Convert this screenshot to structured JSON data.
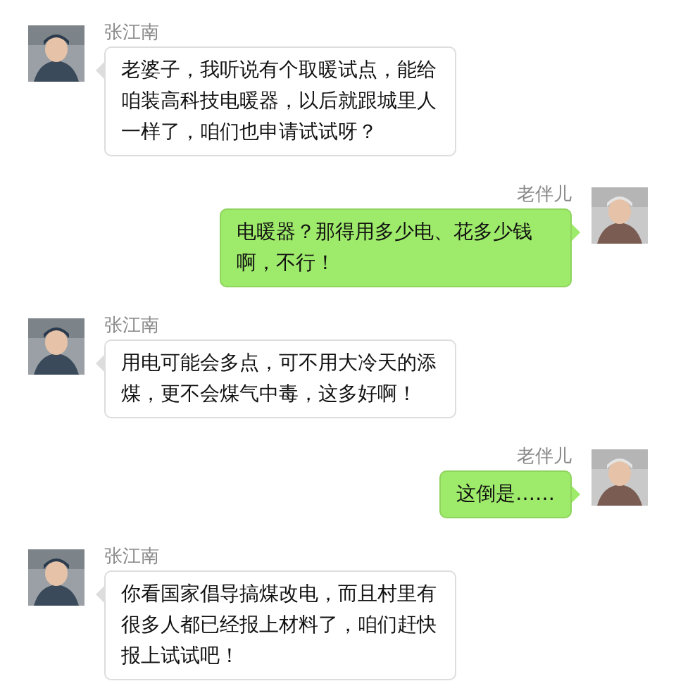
{
  "messages": [
    {
      "kind": "incoming",
      "sender": "张江南",
      "text": "老婆子，我听说有个取暖试点，能给咱装高科技电暖器，以后就跟城里人一样了，咱们也申请试试呀？"
    },
    {
      "kind": "outgoing",
      "sender": "老伴儿",
      "text": "电暖器？那得用多少电、花多少钱啊，不行！"
    },
    {
      "kind": "incoming",
      "sender": "张江南",
      "text": "用电可能会多点，可不用大冷天的添煤，更不会煤气中毒，这多好啊！"
    },
    {
      "kind": "outgoing",
      "sender": "老伴儿",
      "text": "这倒是……"
    },
    {
      "kind": "incoming",
      "sender": "张江南",
      "text": "你看国家倡导搞煤改电，而且村里有很多人都已经报上材料了，咱们赶快报上试试吧！"
    }
  ]
}
